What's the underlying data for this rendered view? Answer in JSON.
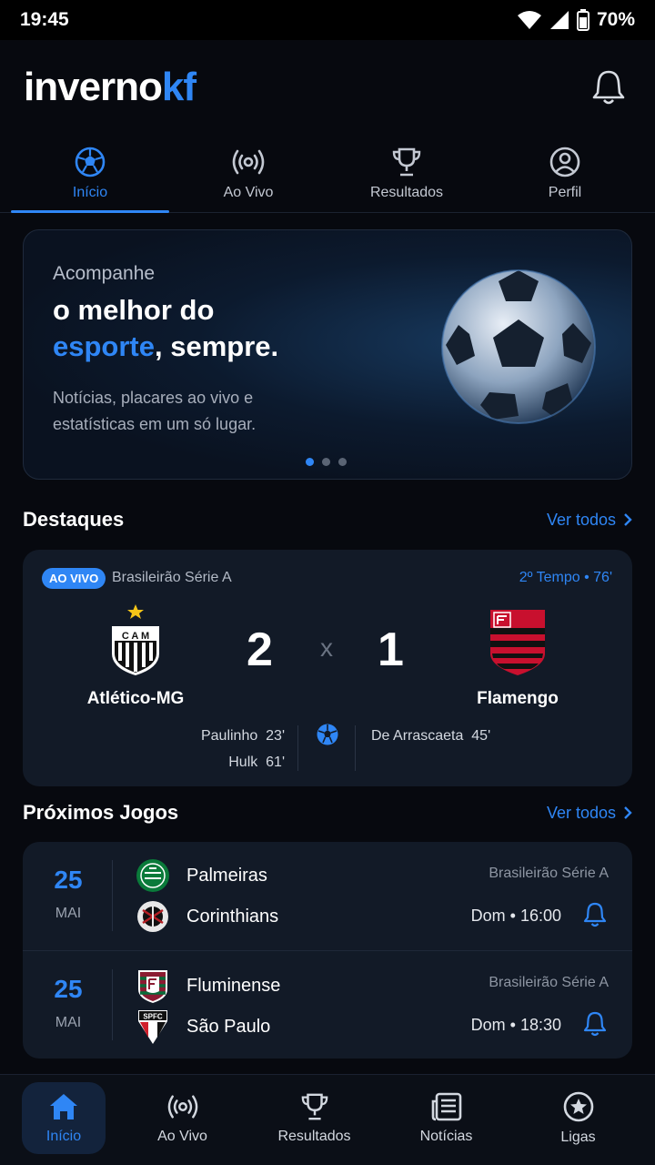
{
  "status_bar": {
    "time": "19:45",
    "battery": "70%"
  },
  "header": {
    "logo_main": "inverno",
    "logo_accent": "kf"
  },
  "top_tabs": [
    {
      "label": "Início",
      "icon": "soccer-ball-icon",
      "active": true
    },
    {
      "label": "Ao Vivo",
      "icon": "broadcast-icon",
      "active": false
    },
    {
      "label": "Resultados",
      "icon": "trophy-icon",
      "active": false
    },
    {
      "label": "Perfil",
      "icon": "user-circle-icon",
      "active": false
    }
  ],
  "hero": {
    "kicker": "Acompanhe",
    "title_line1": "o melhor do",
    "title_highlight": "esporte",
    "title_rest": ", sempre.",
    "subtitle_line1": "Notícias, placares ao vivo e",
    "subtitle_line2": "estatísticas em um só lugar."
  },
  "highlights": {
    "title": "Destaques",
    "see_all": "Ver todos",
    "match": {
      "live_badge": "AO VIVO",
      "league": "Brasileirão Série A",
      "time": "2º Tempo • 76'",
      "home": {
        "name": "Atlético-MG",
        "score": "2",
        "crest_text": "C A M"
      },
      "separator": "x",
      "away": {
        "name": "Flamengo",
        "score": "1"
      },
      "home_scorers": [
        {
          "name": "Paulinho",
          "minute": "23'"
        },
        {
          "name": "Hulk",
          "minute": "61'"
        }
      ],
      "away_scorers": [
        {
          "name": "De Arrascaeta",
          "minute": "45'"
        }
      ]
    }
  },
  "upcoming": {
    "title": "Próximos Jogos",
    "see_all": "Ver todos",
    "fixtures": [
      {
        "day": "25",
        "month": "MAI",
        "home": "Palmeiras",
        "away": "Corinthians",
        "league": "Brasileirão Série A",
        "time": "Dom • 16:00"
      },
      {
        "day": "25",
        "month": "MAI",
        "home": "Fluminense",
        "away": "São Paulo",
        "league": "Brasileirão Série A",
        "time": "Dom • 18:30",
        "away_crest_text": "SPFC"
      }
    ]
  },
  "bottom_nav": [
    {
      "label": "Início",
      "icon": "home-icon",
      "active": true
    },
    {
      "label": "Ao Vivo",
      "icon": "broadcast-icon",
      "active": false
    },
    {
      "label": "Resultados",
      "icon": "trophy-icon",
      "active": false
    },
    {
      "label": "Notícias",
      "icon": "newspaper-icon",
      "active": false
    },
    {
      "label": "Ligas",
      "icon": "star-badge-icon",
      "active": false
    }
  ],
  "colors": {
    "accent": "#2f86f5",
    "background": "#07090f",
    "card": "#121a27"
  }
}
